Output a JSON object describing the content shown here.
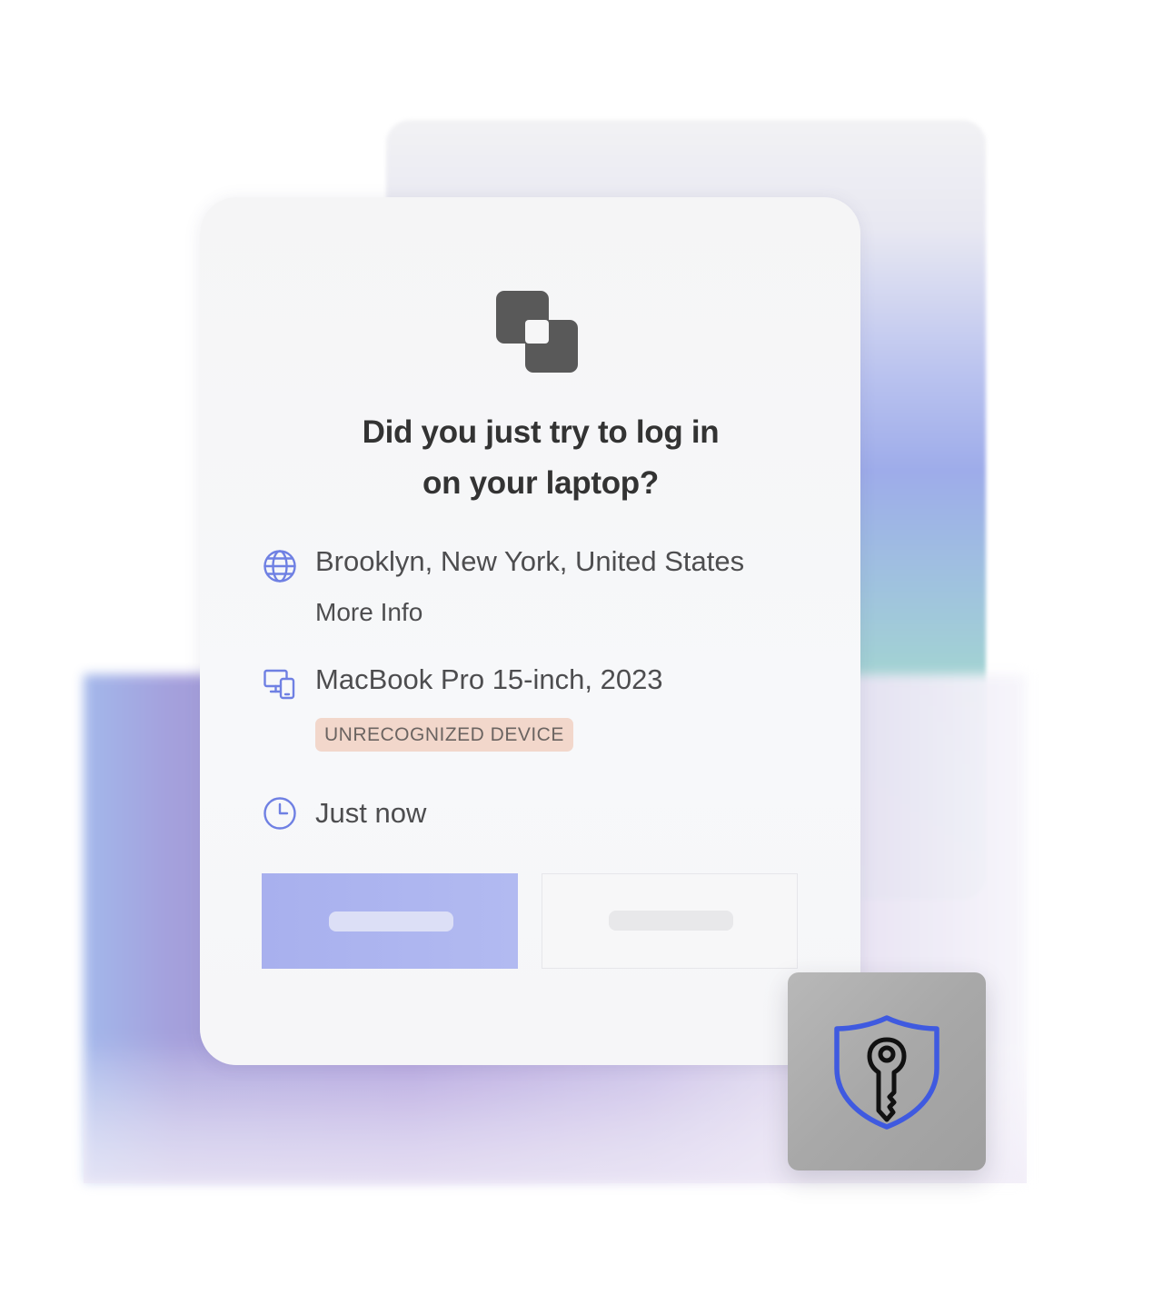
{
  "prompt": {
    "title_line1": "Did you just try to log in",
    "title_line2": "on your laptop?"
  },
  "location": {
    "icon": "globe-icon",
    "text": "Brooklyn, New York, United States",
    "link": "More Info"
  },
  "device": {
    "icon": "devices-icon",
    "text": "MacBook Pro 15-inch, 2023",
    "badge": "UNRECOGNIZED DEVICE"
  },
  "time": {
    "icon": "clock-icon",
    "text": "Just now"
  },
  "buttons": {
    "primary_label": "",
    "secondary_label": ""
  },
  "colors": {
    "accent": "#6f80e3",
    "primary_button": "#adb5f0",
    "badge_bg": "#f2d7cb",
    "logo": "#595959",
    "shield": "#3f5ae0"
  },
  "icons": {
    "app_logo": "app-logo-icon",
    "security": "shield-key-icon"
  }
}
